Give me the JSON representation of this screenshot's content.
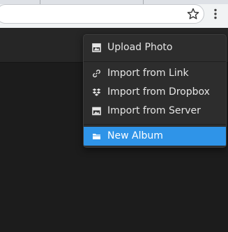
{
  "browser": {
    "bookmark_icon": "star-icon",
    "menu_icon": "vertical-dots-icon"
  },
  "upload_menu": {
    "items": [
      {
        "label": "Upload Photo",
        "icon": "photo-icon"
      },
      {
        "label": "Import from Link",
        "icon": "link-icon"
      },
      {
        "label": "Import from Dropbox",
        "icon": "dropbox-icon"
      },
      {
        "label": "Import from Server",
        "icon": "server-image-icon"
      },
      {
        "label": "New Album",
        "icon": "folder-icon",
        "highlighted": true
      }
    ],
    "highlight_color": "#2f94e8",
    "background_color": "#2d2d2d"
  },
  "colors": {
    "app_background": "#1c1c1c",
    "header_background": "#262626",
    "menu_text": "#e6e6e6"
  }
}
